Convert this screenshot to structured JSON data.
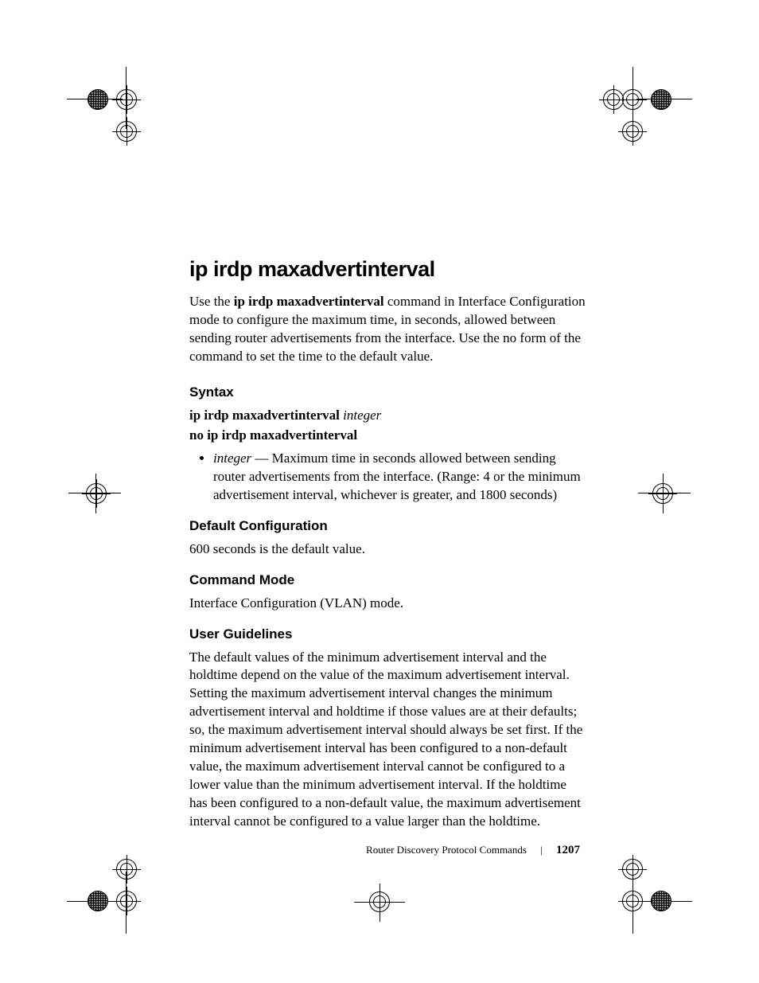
{
  "title": "ip irdp maxadvertinterval",
  "intro_prefix": "Use the ",
  "intro_bold": "ip irdp maxadvertinterval",
  "intro_rest": " command in Interface Configuration mode to configure the maximum time, in seconds, allowed between sending router advertisements from the interface. Use the no form of the command to set the time to the default value.",
  "syntax": {
    "heading": "Syntax",
    "line1_bold": "ip irdp maxadvertinterval ",
    "line1_italic": "integer",
    "line2_bold": "no ip irdp maxadvertinterval",
    "bullet_term": "integer",
    "bullet_sep": " — ",
    "bullet_text": "Maximum time in seconds allowed between sending router advertisements from the interface. (Range: 4 or the minimum advertisement interval, whichever is greater, and 1800 seconds)"
  },
  "default_cfg": {
    "heading": "Default Configuration",
    "text": "600 seconds is the default value."
  },
  "cmd_mode": {
    "heading": "Command Mode",
    "text": "Interface Configuration (VLAN) mode."
  },
  "guidelines": {
    "heading": "User Guidelines",
    "text": "The default values of the minimum advertisement interval and the holdtime depend on the value of the maximum advertisement interval. Setting the maximum advertisement interval changes the minimum advertisement interval and holdtime if those values are at their defaults; so, the maximum advertisement interval should always be set first. If the minimum advertisement interval has been configured to a non-default value, the maximum advertisement interval cannot be configured to a lower value than the minimum advertisement interval. If the holdtime has been configured to a non-default value, the maximum advertisement interval cannot be configured to a value larger than the holdtime."
  },
  "footer": {
    "section": "Router Discovery Protocol Commands",
    "page": "1207"
  }
}
